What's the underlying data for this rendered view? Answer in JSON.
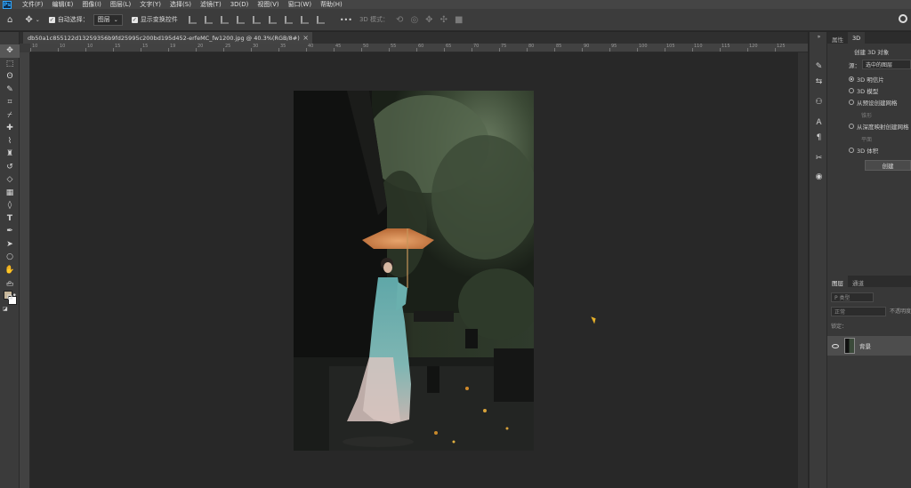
{
  "app": {
    "logo": "Ps"
  },
  "menu": [
    "文件(F)",
    "编辑(E)",
    "图像(I)",
    "图层(L)",
    "文字(Y)",
    "选择(S)",
    "滤镜(T)",
    "3D(D)",
    "视图(V)",
    "窗口(W)",
    "帮助(H)"
  ],
  "options": {
    "auto_select_label": "自动选择：",
    "auto_select_value": "图层",
    "show_transform_label": "显示变换控件",
    "more": "•••",
    "mode_3d_label": "3D 模式："
  },
  "document": {
    "tab_title": "db50a1c855122d13259356b9fd25995c200bd195d452-erfeMC_fw1200.jpg @ 40.3%(RGB/8#)",
    "close": "×"
  },
  "ruler": {
    "top_ticks": [
      "10",
      "10",
      "10",
      "15",
      "15",
      "19",
      "20",
      "25",
      "30",
      "35",
      "40",
      "45",
      "50",
      "55",
      "60",
      "65",
      "70",
      "75",
      "80",
      "85",
      "90",
      "95",
      "100",
      "105",
      "110",
      "115",
      "120",
      "125"
    ]
  },
  "properties_panel": {
    "tabs": [
      "属性",
      "3D"
    ],
    "title": "创建 3D 对象",
    "source_label": "源：",
    "source_value": "选中的图层",
    "options": [
      {
        "label": "3D 明信片",
        "selected": true
      },
      {
        "label": "3D 模型",
        "selected": false
      },
      {
        "label": "从预设创建网格",
        "selected": false
      }
    ],
    "sub_1": "锥形",
    "option_depth": "从深度映射创建网格",
    "sub_2": "平面",
    "option_volume": "3D 体积",
    "create_button": "创建"
  },
  "layers_panel": {
    "tabs": [
      "图层",
      "通道"
    ],
    "kind_placeholder": "P 类型",
    "blend_mode": "正常",
    "opacity_label": "不透明度",
    "lock_label": "锁定：",
    "layers": [
      {
        "name": "背景",
        "visible": true
      }
    ]
  }
}
